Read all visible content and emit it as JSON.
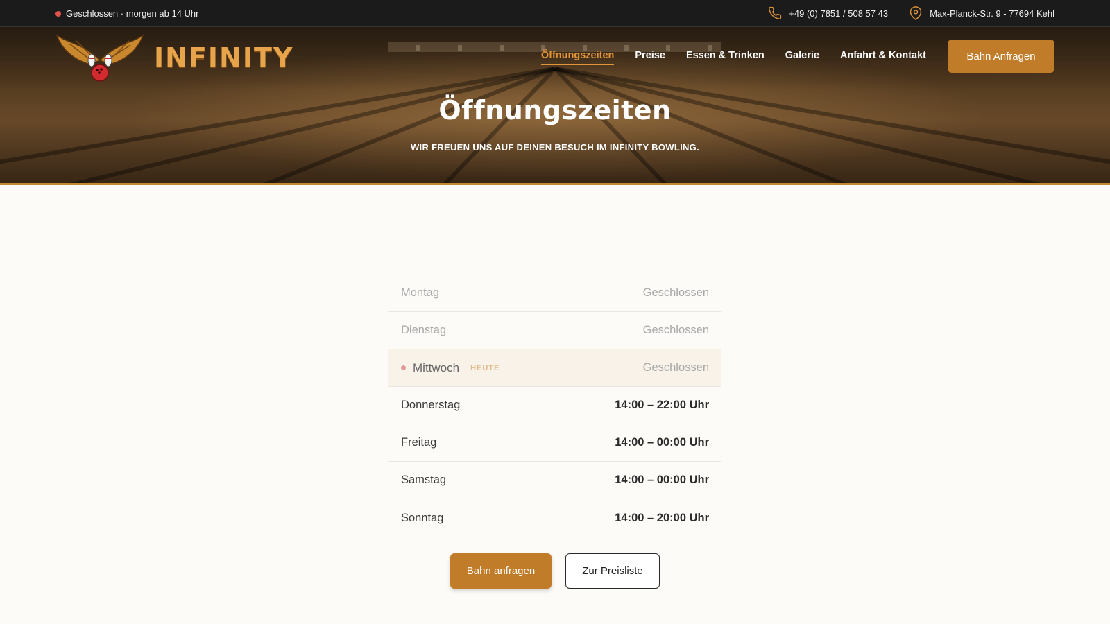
{
  "topbar": {
    "status": "Geschlossen · morgen ab 14 Uhr",
    "phone": "+49 (0) 7851 / 508 57 43",
    "address": "Max-Planck-Str. 9 - 77694 Kehl"
  },
  "brand": {
    "logo_text": "INFINITY"
  },
  "nav": {
    "items": [
      "Öffnungszeiten",
      "Preise",
      "Essen & Trinken",
      "Galerie",
      "Anfahrt & Kontakt"
    ],
    "active": "Öffnungszeiten",
    "cta": "Bahn Anfragen"
  },
  "hero": {
    "title": "Öffnungszeiten",
    "subtitle": "WIR FREUEN UNS AUF DEINEN BESUCH IM INFINITY BOWLING."
  },
  "hours": [
    {
      "day": "Montag",
      "time": "Geschlossen"
    },
    {
      "day": "Dienstag",
      "time": "Geschlossen"
    },
    {
      "day": "Mittwoch",
      "badge": "HEUTE",
      "time": "Geschlossen"
    },
    {
      "day": "Donnerstag",
      "time": "14:00 – 22:00 Uhr"
    },
    {
      "day": "Freitag",
      "time": "14:00 – 00:00 Uhr"
    },
    {
      "day": "Samstag",
      "time": "14:00 – 00:00 Uhr"
    },
    {
      "day": "Sonntag",
      "time": "14:00 – 20:00 Uhr"
    }
  ],
  "actions": {
    "primary": "Bahn anfragen",
    "secondary": "Zur Preisliste"
  },
  "colors": {
    "accent": "#c07c28",
    "nav_active": "#e3953a",
    "status_dot": "#e0544a",
    "topbar_bg": "#1b1b1b"
  },
  "icons": {
    "phone": "phone-icon",
    "location": "location-pin-icon",
    "logo": "bowling-wings-logo-icon"
  }
}
